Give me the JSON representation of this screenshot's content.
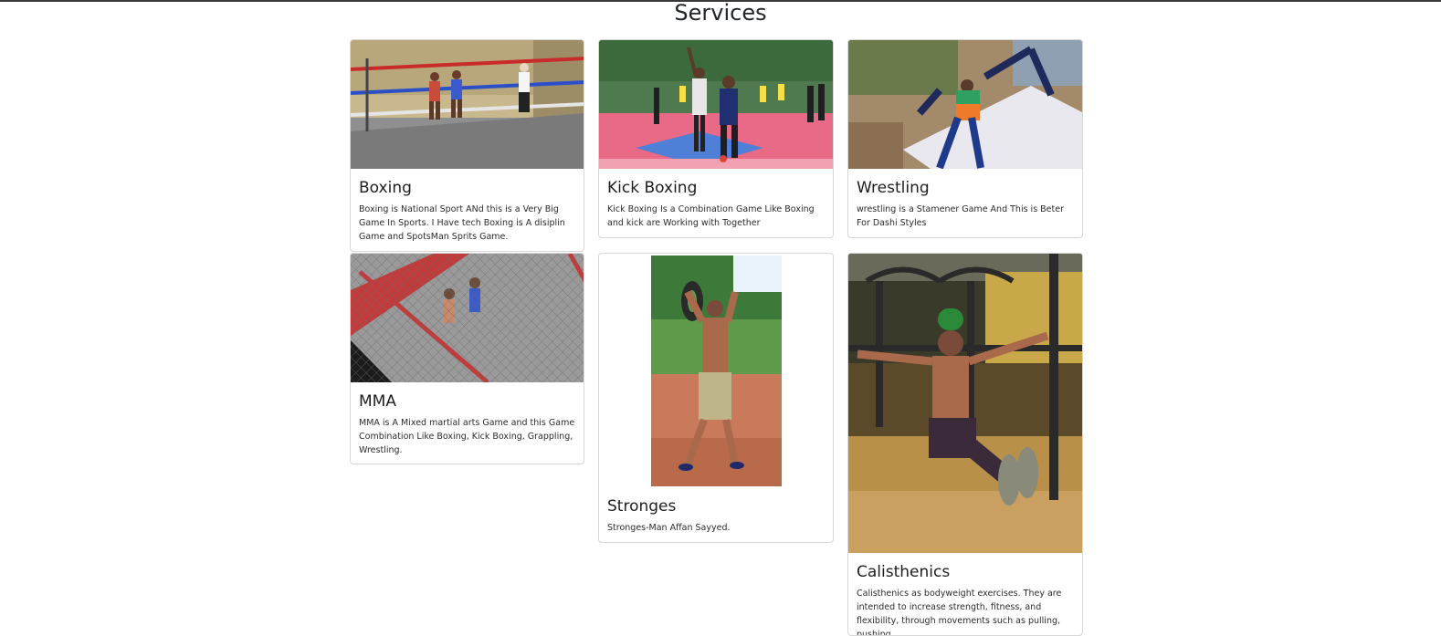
{
  "page": {
    "heading": "Services"
  },
  "cards": [
    {
      "id": "boxing",
      "title": "Boxing",
      "text": "Boxing is National Sport ANd this is a Very Big Game In Sports. I Have tech Boxing is A disiplin Game and SpotsMan Sprits Game.",
      "image": "boxing-ring-photo"
    },
    {
      "id": "kick-boxing",
      "title": "Kick Boxing",
      "text": "Kick Boxing Is a Combination Game Like Boxing and kick are Working with Together",
      "image": "kickboxing-mat-photo"
    },
    {
      "id": "wrestling",
      "title": "Wrestling",
      "text": "wrestling is a Stamener Game And This is Beter For Dashi Styles",
      "image": "wrestling-photo"
    },
    {
      "id": "mma",
      "title": "MMA",
      "text": "MMA is A Mixed martial arts Game and this Game Combination Like Boxing, Kick Boxing, Grappling, Wrestling.",
      "image": "mma-cage-photo"
    },
    {
      "id": "stronges",
      "title": "Stronges",
      "text": "Stronges-Man Affan Sayyed.",
      "image": "tire-lift-photo"
    },
    {
      "id": "calisthenics",
      "title": "Calisthenics",
      "text": "Calisthenics as bodyweight exercises. They are intended to increase strength, fitness, and flexibility, through movements such as pulling, pushing,",
      "image": "parallel-bars-photo"
    }
  ]
}
